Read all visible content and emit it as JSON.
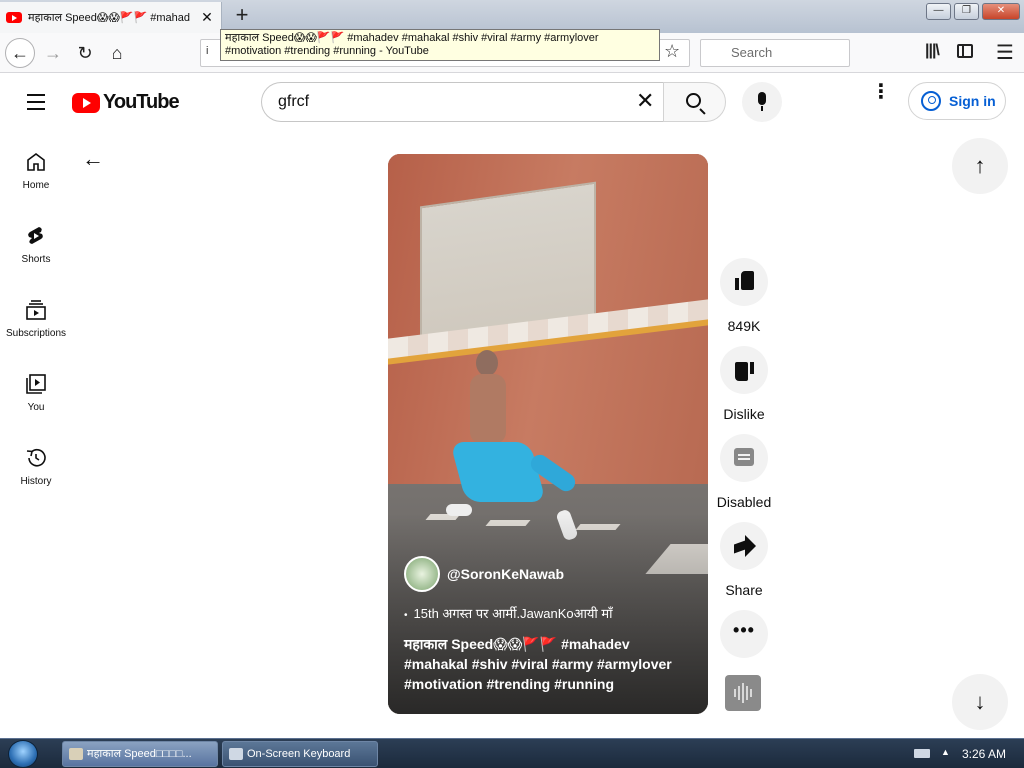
{
  "browser": {
    "tab_title": "महाकाल Speed😱😱🚩🚩 #mahad",
    "tab_close": "✕",
    "new_tab": "+",
    "tooltip_line1": "महाकाल Speed😱😱🚩🚩 #mahadev #mahakal #shiv #viral #army #armylover",
    "tooltip_line2": "#motivation #trending #running - YouTube",
    "url_info": "i",
    "search_placeholder": "Search",
    "window_controls": [
      "—",
      "❐",
      "✕"
    ]
  },
  "yt": {
    "logo_text": "YouTube",
    "search_query": "gfrcf",
    "clear_glyph": "✕",
    "more_glyph": "⋮",
    "signin_label": "Sign in"
  },
  "guide": {
    "items": [
      {
        "label": "Home",
        "icon": "home-icon"
      },
      {
        "label": "Shorts",
        "icon": "shorts-icon"
      },
      {
        "label": "Subscriptions",
        "icon": "subscriptions-icon"
      },
      {
        "label": "You",
        "icon": "you-icon"
      },
      {
        "label": "History",
        "icon": "history-icon"
      }
    ]
  },
  "short": {
    "channel_handle": "@SoronKeNawab",
    "music_bullet": "•",
    "music_text": "15th अगस्त पर आर्मी.JawanKoआयी माँ",
    "title": "महाकाल Speed😱😱🚩🚩 #mahadev #mahakal #shiv #viral #army #armylover #motivation #trending #running"
  },
  "actions": {
    "likes": "849K",
    "dislike_label": "Dislike",
    "comments_label": "Disabled",
    "share_label": "Share",
    "more_glyph": "•••"
  },
  "navigation": {
    "back_arrow": "←",
    "up_arrow": "↑",
    "down_arrow": "↓"
  },
  "taskbar": {
    "browser_task": "महाकाल Speed□□□□...",
    "keyboard_task": "On-Screen Keyboard",
    "tray_arrow": "▲",
    "clock": "3:26 AM"
  },
  "colors": {
    "brand_red": "#ff0000",
    "link_blue": "#065fd4"
  }
}
